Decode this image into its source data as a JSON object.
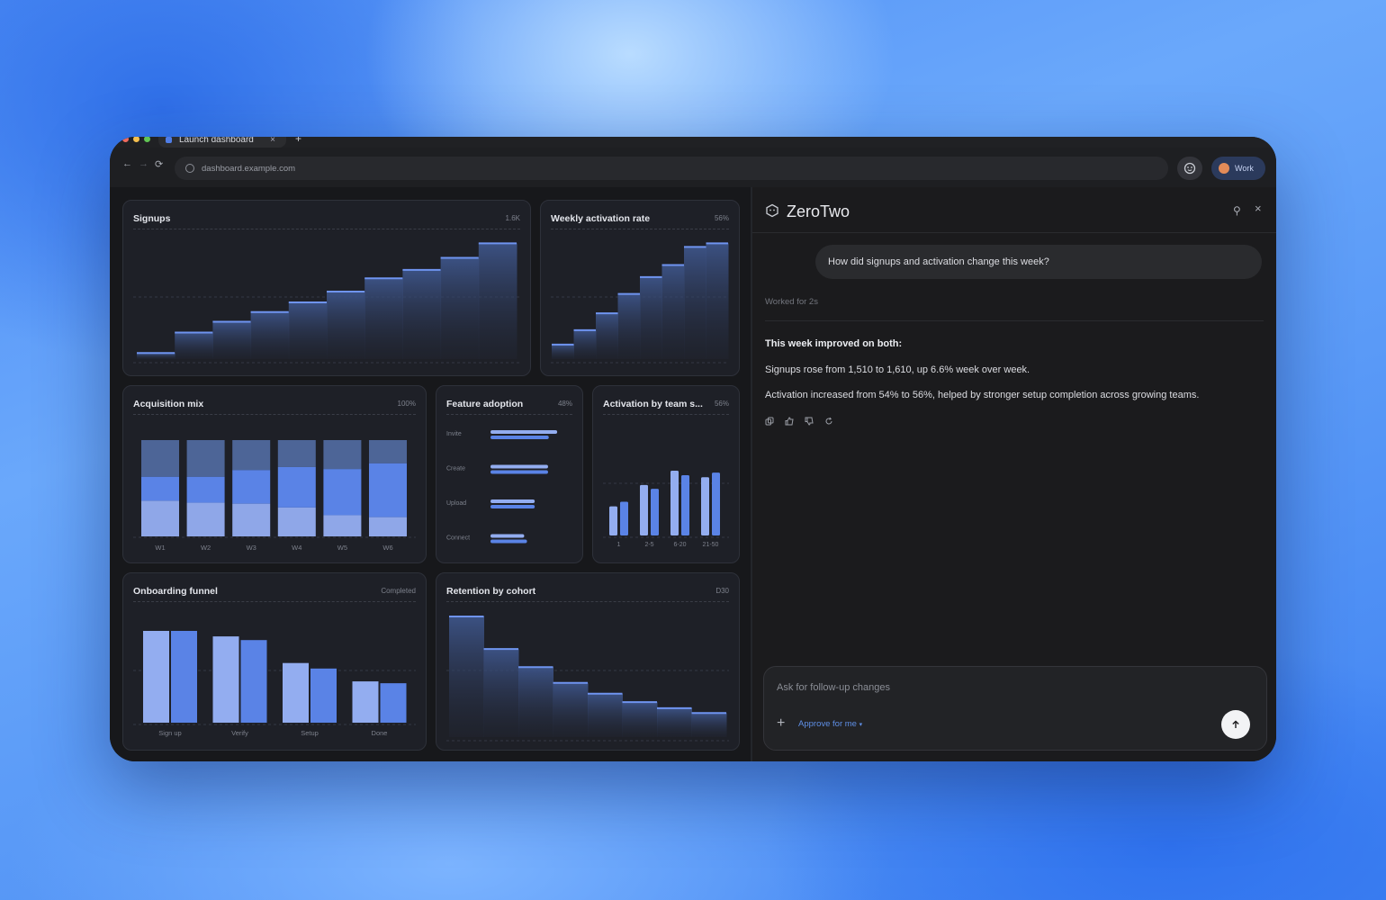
{
  "browser": {
    "tab_title": "Launch dashboard",
    "tab_close": "×",
    "new_tab": "+",
    "url": "dashboard.example.com",
    "profile_label": "Work",
    "nav": {
      "back": "←",
      "forward": "→",
      "reload": "⟳"
    }
  },
  "dashboard": {
    "signups": {
      "title": "Signups",
      "meta": "1.6K"
    },
    "weekly_activation": {
      "title": "Weekly activation rate",
      "meta": "56%"
    },
    "acquisition_mix": {
      "title": "Acquisition mix",
      "meta": "100%"
    },
    "feature_adoption": {
      "title": "Feature adoption",
      "meta": "48%"
    },
    "activation_by_team": {
      "title": "Activation by team s...",
      "meta": "56%"
    },
    "onboarding_funnel": {
      "title": "Onboarding funnel",
      "meta": "Completed"
    },
    "retention": {
      "title": "Retention by cohort",
      "meta": "D30"
    }
  },
  "chart_data": [
    {
      "type": "area",
      "name": "Signups",
      "x": [
        1,
        2,
        3,
        4,
        5,
        6,
        7,
        8,
        9,
        10
      ],
      "values": [
        0.05,
        0.22,
        0.31,
        0.39,
        0.47,
        0.56,
        0.67,
        0.74,
        0.84,
        0.96
      ]
    },
    {
      "type": "area",
      "name": "Weekly activation rate",
      "x": [
        1,
        2,
        3,
        4,
        5,
        6,
        7,
        8
      ],
      "values": [
        0.12,
        0.24,
        0.38,
        0.54,
        0.68,
        0.78,
        0.93,
        0.96
      ]
    },
    {
      "type": "bar",
      "stacked": true,
      "categories": [
        "W1",
        "W2",
        "W3",
        "W4",
        "W5",
        "W6"
      ],
      "series": [
        {
          "values": [
            37,
            35,
            34,
            30,
            22,
            20
          ],
          "color": "#8fa7e8"
        },
        {
          "values": [
            25,
            27,
            35,
            42,
            48,
            56
          ],
          "color": "#5a83e6"
        },
        {
          "values": [
            38,
            38,
            31,
            28,
            30,
            24
          ],
          "color": "#4d6597"
        }
      ]
    },
    {
      "type": "bar",
      "orientation": "horizontal",
      "categories": [
        "Invite",
        "Create",
        "Upload",
        "Connect"
      ],
      "series": [
        {
          "values": [
            0.95,
            0.82,
            0.63,
            0.48
          ]
        },
        {
          "values": [
            0.83,
            0.82,
            0.63,
            0.52
          ]
        }
      ]
    },
    {
      "type": "bar",
      "categories": [
        "1",
        "2-5",
        "6-20",
        "21-50"
      ],
      "series": [
        {
          "values": [
            0.45,
            0.78,
            1.0,
            0.9
          ],
          "color": "#93adf0"
        },
        {
          "values": [
            0.52,
            0.72,
            0.93,
            0.97
          ],
          "color": "#5a83e6"
        }
      ]
    },
    {
      "type": "bar",
      "categories": [
        "Sign up",
        "Verify",
        "Setup",
        "Done"
      ],
      "series": [
        {
          "values": [
            1.0,
            0.94,
            0.65,
            0.45
          ],
          "color": "#93adf0"
        },
        {
          "values": [
            1.0,
            0.9,
            0.59,
            0.43
          ],
          "color": "#5a83e6"
        }
      ]
    },
    {
      "type": "area",
      "name": "Retention by cohort",
      "x": [
        1,
        2,
        3,
        4,
        5,
        6,
        7,
        8
      ],
      "values": [
        1.0,
        0.73,
        0.58,
        0.45,
        0.36,
        0.29,
        0.24,
        0.2
      ]
    }
  ],
  "assistant": {
    "name": "ZeroTwo",
    "user_message": "How did signups and activation change this week?",
    "worked_for": "Worked for 2s",
    "response_heading": "This week improved on both:",
    "response_line1": "Signups rose from 1,510 to 1,610, up 6.6% week over week.",
    "response_line2": "Activation increased from 54% to 56%, helped by stronger setup completion across growing teams.",
    "composer_placeholder": "Ask for follow-up changes",
    "approve_label": "Approve for me",
    "pin": "⚲",
    "close": "×"
  },
  "colors": {
    "accent": "#5a83e6",
    "bar_light": "#93adf0",
    "bar_dark": "#4d6597"
  }
}
